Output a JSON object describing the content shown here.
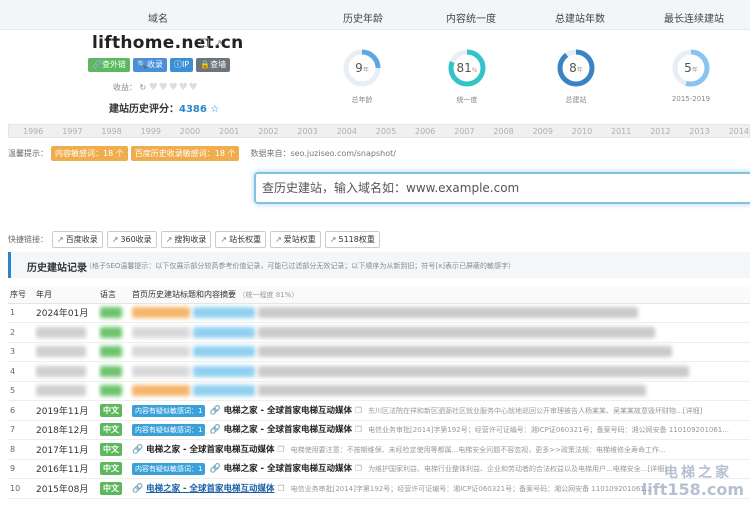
{
  "header": {
    "col_domain": "域名",
    "col_age": "历史年龄",
    "col_unity": "内容统一度",
    "col_years": "总建站年数",
    "col_streak": "最长连续建站"
  },
  "domain": {
    "name": "lifthome.net.cn",
    "tags": [
      "查外链",
      "收录",
      "IP",
      "查墙"
    ],
    "shoulu_label": "收益：",
    "score_label": "建站历史评分：",
    "score_value": "4386"
  },
  "rings": [
    {
      "value": "9",
      "unit": "年",
      "caption": "总年龄",
      "percent": 0.25,
      "color": "#5aa9e6"
    },
    {
      "value": "81",
      "unit": "%",
      "caption": "统一度",
      "percent": 0.81,
      "color": "#33c3c8"
    },
    {
      "value": "8",
      "unit": "年",
      "caption": "总建站",
      "percent": 0.9,
      "color": "#3a84c4"
    },
    {
      "value": "5",
      "unit": "年",
      "caption": "2015-2019",
      "percent": 0.55,
      "color": "#88c4ef"
    }
  ],
  "timeline": [
    "1996",
    "1997",
    "1998",
    "1999",
    "2000",
    "2001",
    "2002",
    "2003",
    "2004",
    "2005",
    "2006",
    "2007",
    "2008",
    "2009",
    "2010",
    "2011",
    "2012",
    "2013",
    "2014"
  ],
  "tips": {
    "label": "温馨提示：",
    "sensitive": "内容敏感词：18 个",
    "baidu": "百度历史收录敏感词：18 个",
    "source": "数据来自：seo.juziseo.com/snapshot/"
  },
  "search": {
    "placeholder": "查历史建站，输入域名如：www.example.com"
  },
  "quick": {
    "label": "快捷链接：",
    "links": [
      "百度收录",
      "360收录",
      "搜狗收录",
      "站长权重",
      "爱站权重",
      "5118权重"
    ]
  },
  "history": {
    "title": "历史建站记录",
    "note": "（格子SEO温馨提示：以下仅展示部分较高参考价值记录，可能已过滤部分无效记录；以下顺序为从新到旧；符号[x]表示已屏蔽的敏感字）",
    "columns": {
      "num": "序号",
      "month": "年月",
      "lang": "语言",
      "title": "首页历史建站标题和内容摘要",
      "unity": "（统一程度 81%）"
    },
    "rows": [
      {
        "num": "1",
        "month": "2024年01月",
        "lang": "",
        "kw": "",
        "title": "",
        "desc": ""
      },
      {
        "num": "2",
        "month": "",
        "lang": "",
        "kw": "",
        "title": "",
        "desc": ""
      },
      {
        "num": "3",
        "month": "",
        "lang": "",
        "kw": "",
        "title": "",
        "desc": ""
      },
      {
        "num": "4",
        "month": "",
        "lang": "",
        "kw": "",
        "title": "",
        "desc": ""
      },
      {
        "num": "5",
        "month": "",
        "lang": "",
        "kw": "",
        "title": "",
        "desc": ""
      },
      {
        "num": "6",
        "month": "2019年11月",
        "lang": "中文",
        "kw": "内容有疑似敏感词：1",
        "title": "电梯之家 - 全球首家电梯互动媒体",
        "desc": "东川区法院在祥和新区驷源社区就业服务中心就地巡回公开审理被告人杨某某、吴某某故意毁坏财物...[详细]"
      },
      {
        "num": "7",
        "month": "2018年12月",
        "lang": "中文",
        "kw": "内容有疑似敏感词：1",
        "title": "电梯之家 - 全球首家电梯互动媒体",
        "desc": "电信业务审批[2014]字第192号；经营许可证编号：湘ICP证060321号；备案号码：湘公网安备 110109201061..."
      },
      {
        "num": "8",
        "month": "2017年11月",
        "lang": "中文",
        "kw": "",
        "title": "电梯之家 - 全球首家电梯互动媒体",
        "desc": "电梯使用要注意：不按期维保、未经检定使用等都属...电梯安全问题不容忽视，更多>>政策法规：电梯维修全寿命工作..."
      },
      {
        "num": "9",
        "month": "2016年11月",
        "lang": "中文",
        "kw": "内容有疑似敏感词：1",
        "title": "电梯之家 - 全球首家电梯互动媒体",
        "desc": "为维护国家利益、电梯行业整体利益、企业和劳动者的合法权益以及电梯用户...电梯安全...[详细]"
      },
      {
        "num": "10",
        "month": "2015年08月",
        "lang": "中文",
        "kw": "",
        "title": "电梯之家 - 全球首家电梯互动媒体",
        "desc": "电信业务审批[2014]字第192号；经营许可证编号：湘ICP证060321号；备案号码：湘公网安备 110109201061..."
      }
    ]
  },
  "watermark": {
    "line1": "电梯之家",
    "line2": "lift158.com"
  }
}
